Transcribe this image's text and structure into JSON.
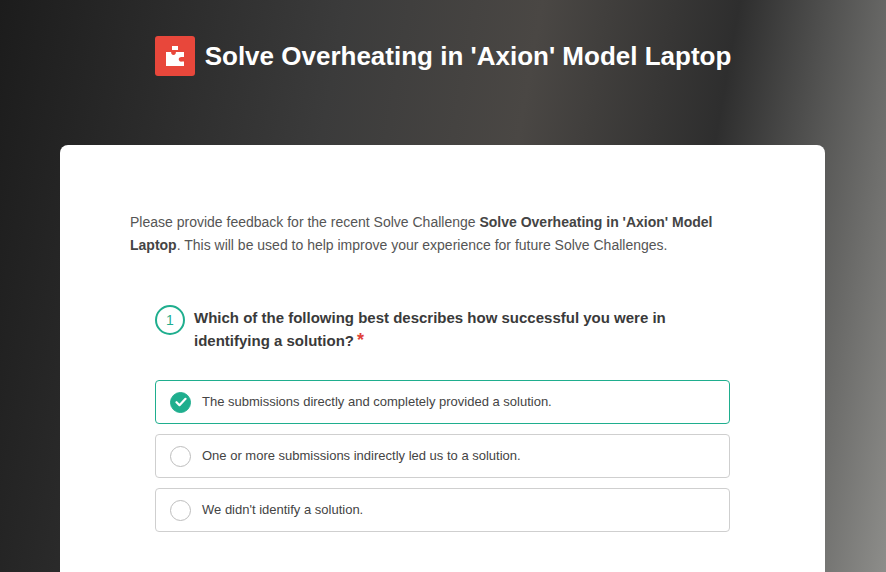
{
  "header": {
    "title": "Solve Overheating in 'Axion' Model Laptop"
  },
  "intro": {
    "before": "Please provide feedback for the recent Solve Challenge ",
    "challenge": "Solve Overheating in 'Axion' Model Laptop",
    "after": ". This will be used to help improve your experience for future Solve Challenges."
  },
  "question": {
    "number": "1",
    "text": "Which of the following best describes how successful you were in identifying a solution?",
    "required_mark": "*",
    "options": [
      {
        "label": "The submissions directly and completely provided a solution.",
        "selected": true
      },
      {
        "label": "One or more submissions indirectly led us to a solution.",
        "selected": false
      },
      {
        "label": "We didn't identify a solution.",
        "selected": false
      }
    ]
  }
}
